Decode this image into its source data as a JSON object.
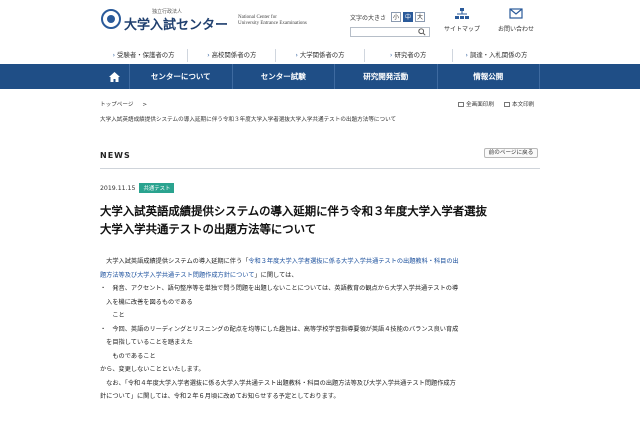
{
  "header": {
    "logo_small": "独立行政法人",
    "logo_main": "大学入試センター",
    "logo_en_line1": "National Center for",
    "logo_en_line2": "University Entrance Examinations",
    "font_size_label": "文字の大きさ",
    "font_sizes": [
      "小",
      "中",
      "大"
    ],
    "sitemap_label": "サイトマップ",
    "contact_label": "お問い合わせ"
  },
  "audience_links": [
    "受験者・保護者の方",
    "高校関係者の方",
    "大学関係者の方",
    "研究者の方",
    "調達・入札関係の方"
  ],
  "nav": {
    "items": [
      "センターについて",
      "センター試験",
      "研究開発活動",
      "情報公開"
    ]
  },
  "breadcrumb": {
    "home": "トップページ",
    "separator": ">"
  },
  "util_links": {
    "print_all": "全画面印刷",
    "print_body": "本文印刷"
  },
  "page_subtitle": "大学入試英語成績提供システムの導入延期に伴う令和３年度大学入学者選抜大学入学共通テストの出題方法等について",
  "section": {
    "title": "NEWS",
    "back_label": "前のページに戻る"
  },
  "article": {
    "date": "2019.11.15",
    "tag": "共通テスト",
    "title_line1": "大学入試英語成績提供システムの導入延期に伴う令和３年度大学入学者選抜",
    "title_line2": "大学入学共通テストの出題方法等について",
    "p1_pre": "　大学入試英語成績提供システムの導入延期に伴う「",
    "p1_link_a": "令和３年度大学入学者選抜に係る大学入学共通テストの出題教科・科目の出",
    "p1_link_b": "題方法等及び大学入学共通テスト問題作成方針について",
    "p1_post": "」に関しては、",
    "b1_line1": "・　発音、アクセント、語句整序等を単独で問う問題を出題しないことについては、英語教育の観点から大学入学共通テストの導",
    "b1_line2": "　入を機に改善を図るものである",
    "b1_line3": "　　こと",
    "b2_line1": "・　今回、英語のリーディングとリスニングの配点を均等にした趣旨は、高等学校学習指導要領が英語４技能のバランス良い育成",
    "b2_line2": "　を目指していることを踏まえた",
    "b2_line3": "　　ものであること",
    "p2": "から、変更しないことといたします。",
    "p3_line1": "　なお、「令和４年度大学入学者選抜に係る大学入学共通テスト出題教科・科目の出題方法等及び大学入学共通テスト問題作成方",
    "p3_line2": "針について」に関しては、令和２年６月頃に改めてお知らせする予定としております。"
  },
  "colors": {
    "nav_bg": "#1f4e86",
    "tag_bg": "#2aa38f",
    "link": "#1a4f9c"
  }
}
